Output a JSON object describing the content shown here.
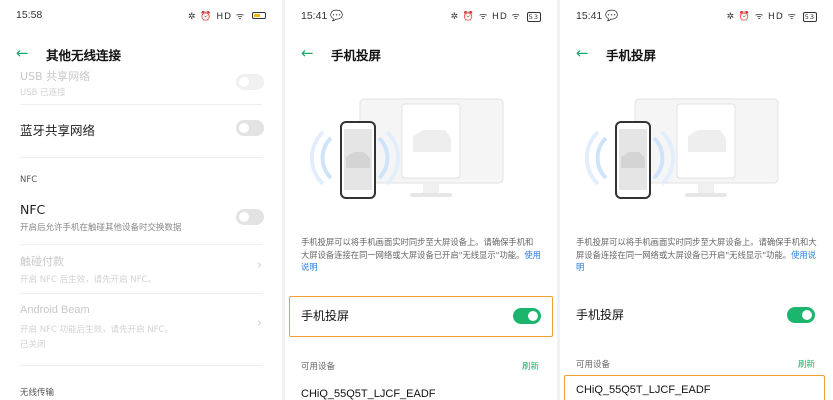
{
  "panel1": {
    "time": "15:58",
    "status_icons": "✲ ⏰ HD ᯤ",
    "title": "其他无线连接",
    "rows": [
      {
        "title": "USB 共享网络",
        "sub": "USB 已连接"
      },
      {
        "title": "蓝牙共享网络"
      },
      {
        "section": "NFC"
      },
      {
        "title": "NFC",
        "sub": "开启后允许手机在触碰其他设备时交换数据"
      },
      {
        "title": "触碰付款",
        "sub": "开启 NFC 后生效，请先开启 NFC。"
      },
      {
        "title": "Android Beam",
        "sub": "开启 NFC 功能后生效，请先开启 NFC。",
        "sub2": "已关闭"
      },
      {
        "section": "无线传输"
      }
    ]
  },
  "panel2": {
    "time": "15:41",
    "status_icons": "✲ ⏰ ᯤ HD ᯤ",
    "battery": "53",
    "title": "手机投屏",
    "desc": "手机投屏可以将手机画面实时同步至大屏设备上。请确保手机和大屏设备连接在同一网络或大屏设备已开启\"无线显示\"功能。",
    "desc_link": "使用说明",
    "toggle_label": "手机投屏",
    "available_label": "可用设备",
    "refresh": "刷新",
    "device": "CHiQ_55Q5T_LJCF_EADF"
  },
  "panel3": {
    "time": "15:41",
    "status_icons": "✲ ⏰ ᯤ HD ᯤ",
    "battery": "53",
    "title": "手机投屏",
    "desc": "手机投屏可以将手机画面实时同步至大屏设备上。请确保手机和大屏设备连接在同一网络或大屏设备已开启\"无线显示\"功能。",
    "desc_link": "使用说明",
    "toggle_label": "手机投屏",
    "available_label": "可用设备",
    "refresh": "刷新",
    "device": "CHiQ_55Q5T_LJCF_EADF"
  },
  "colors": {
    "accent": "#1bb56e",
    "highlight": "#f0a030",
    "link": "#2b7de0"
  }
}
